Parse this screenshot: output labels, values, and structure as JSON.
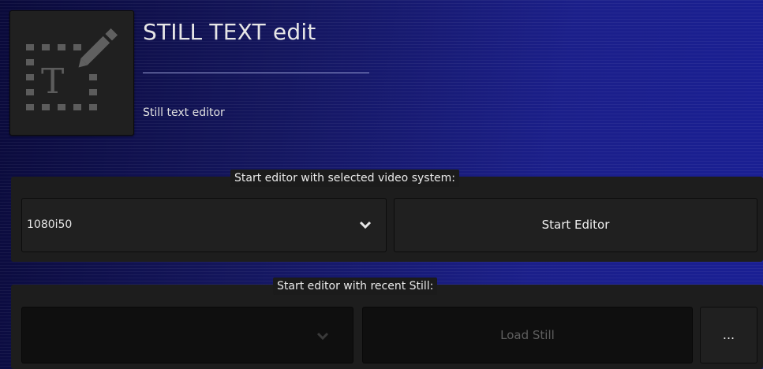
{
  "header": {
    "icon": "still-text-edit-icon",
    "title": "STILL TEXT edit",
    "subtitle": "Still text editor"
  },
  "video_system": {
    "caption": "Start editor with selected video system:",
    "selected": "1080i50",
    "start_label": "Start Editor"
  },
  "recent_still": {
    "caption": "Start editor with recent Still:",
    "selected": "",
    "load_label": "Load Still",
    "browse_label": "..."
  },
  "colors": {
    "background": "#1a1f94",
    "panel": "#1d1d1d",
    "control": "#202020",
    "disabled_control": "#0f0f0f",
    "disabled_text": "#5f5f5f"
  }
}
